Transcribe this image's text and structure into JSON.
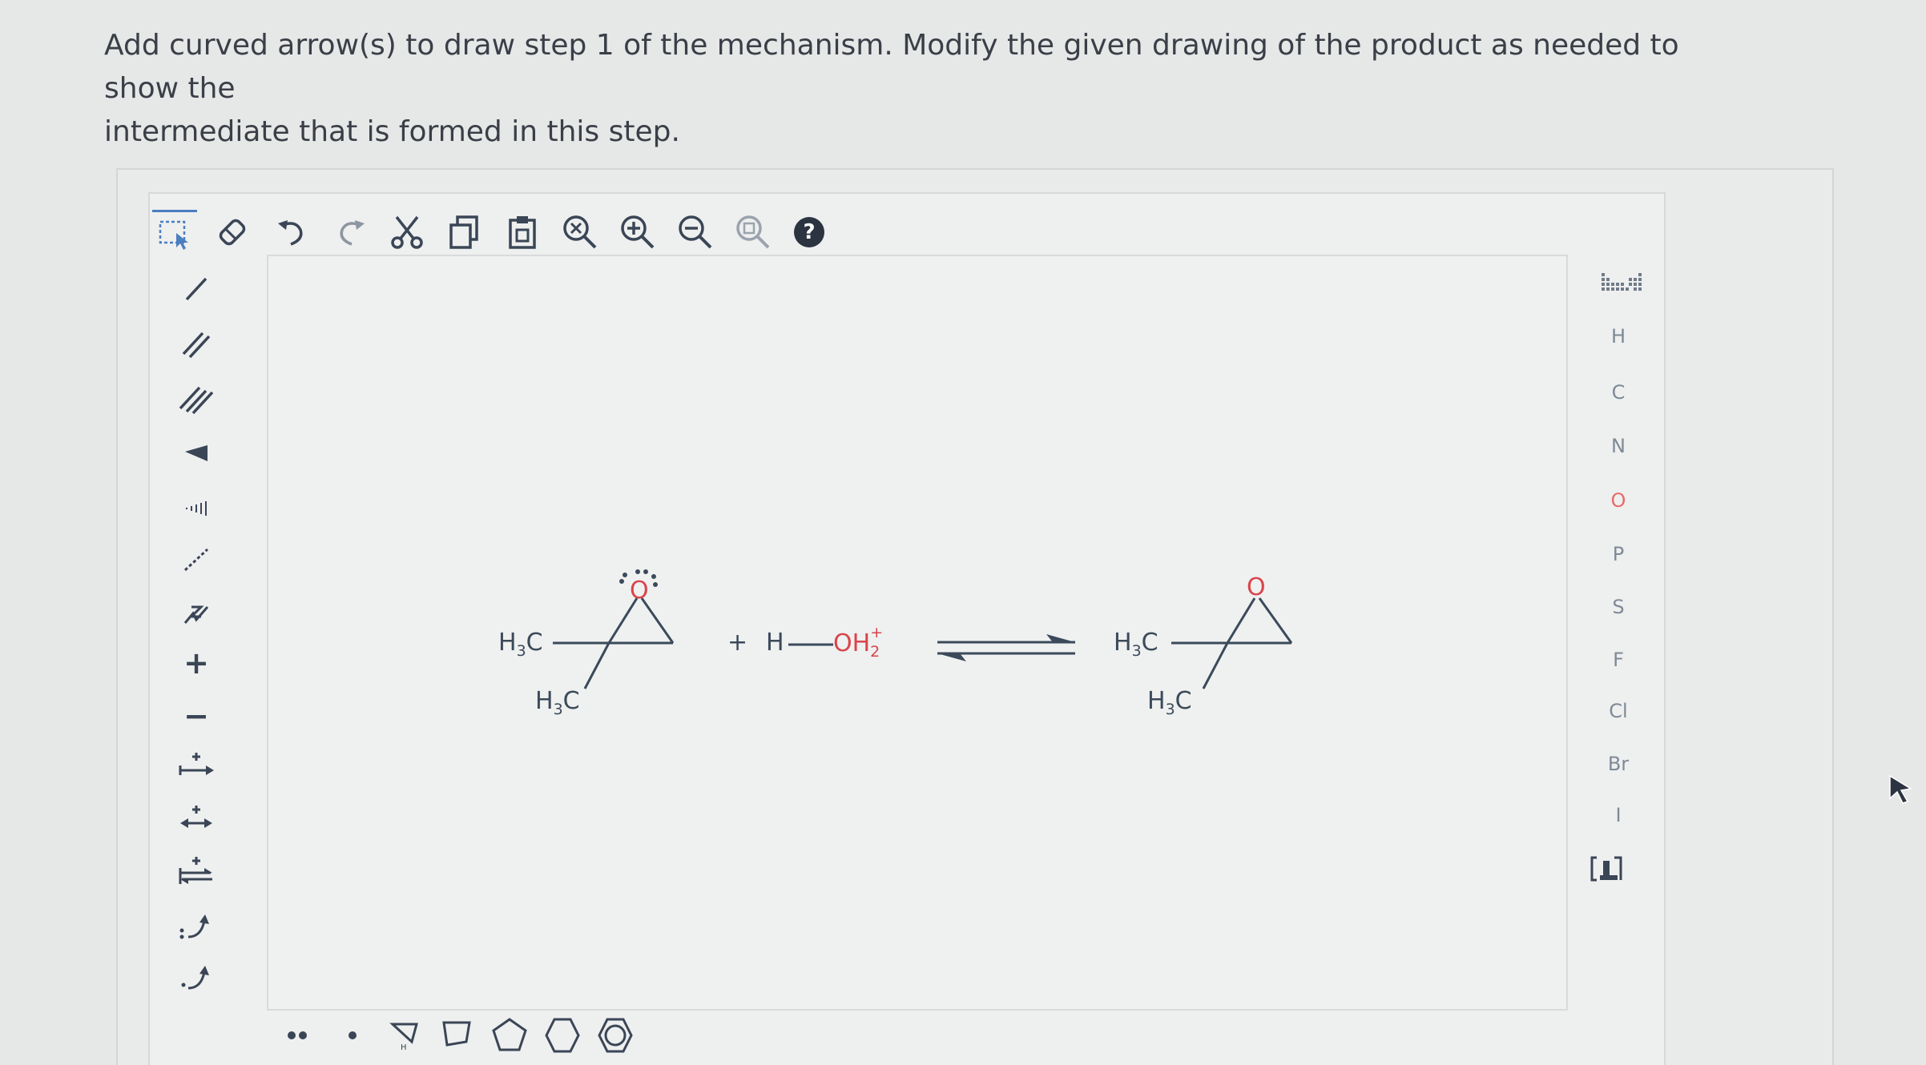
{
  "question": {
    "line1": "Add curved arrow(s) to draw step 1 of the mechanism. Modify the given drawing of the product as needed to show the",
    "line2": "intermediate that is formed in this step."
  },
  "toolbar": {
    "top_tools": [
      "select-tool",
      "eraser-tool",
      "undo",
      "redo",
      "cut",
      "copy",
      "paste",
      "zoom-reset",
      "zoom-in",
      "zoom-out",
      "zoom-fit",
      "help"
    ],
    "help_label": "?"
  },
  "elements": {
    "items": [
      "H",
      "C",
      "N",
      "O",
      "P",
      "S",
      "F",
      "Cl",
      "Br",
      "I"
    ]
  },
  "side_tools": {
    "charge_plus": "+",
    "charge_minus": "−",
    "arrow_plus": "+"
  },
  "reaction": {
    "reactant_methyl_top": "H3C",
    "reactant_methyl_bottom": "H3C",
    "reactant_oxygen": "O",
    "plus": "+",
    "reagent_h": "H",
    "reagent_oh2": "OH",
    "product_methyl_top": "H3C",
    "product_methyl_bottom": "H3C",
    "product_oxygen": "O"
  },
  "colors": {
    "oxygen": "#d9444a",
    "bond": "#3b4a5a",
    "toolbar_icon": "#3a4656"
  }
}
